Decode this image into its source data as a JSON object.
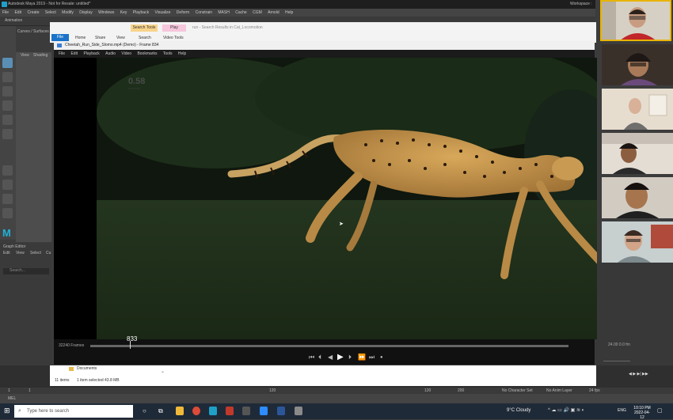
{
  "maya": {
    "title": "Autodesk Maya 2019 - Not for Resale: untitled*",
    "menu": [
      "File",
      "Edit",
      "Create",
      "Select",
      "Modify",
      "Display",
      "Windows",
      "Key",
      "Playback",
      "Visualize",
      "Deform",
      "Constrain",
      "MASH",
      "Cache",
      "CGM",
      "Arnold",
      "Help"
    ],
    "workspace_label": "Workspace :",
    "mode_dropdown": "Animation",
    "curves_tab": "Curves / Surfaces",
    "view_tab": "View",
    "shading_tab": "Shading",
    "graph_editor_title": "Graph Editor",
    "graph_editor_menu": [
      "Edit",
      "View",
      "Select",
      "Cu"
    ],
    "graph_search_placeholder": "Search...",
    "timeline_values": [
      "1",
      "1",
      "120",
      "120",
      "200"
    ],
    "no_character_set": "No Character Set",
    "no_anim_layer": "No Anim Layer",
    "fps": "24 fps",
    "mel_label": "MEL"
  },
  "explorer": {
    "file_tab": "File",
    "tabs": [
      "Home",
      "Share",
      "View"
    ],
    "search_tools": "Search Tools",
    "play": "Play",
    "subtabs": [
      "Search",
      "Video Tools"
    ],
    "address": "run - Search Results in Cat_Locomotion",
    "item_count": "11 items",
    "selected_info": "1 item selected  43.8 MB",
    "documents_label": "Documents"
  },
  "player": {
    "title": "Cheetah_Run_Side_Slomo.mp4 (Demo) - Frame 834",
    "menu": [
      "File",
      "Edit",
      "Playback",
      "Audio",
      "Video",
      "Bookmarks",
      "Tools",
      "Help"
    ],
    "elapsed": "0.58",
    "elapsed_unit": "seconds",
    "frames_total": "32240 Frames",
    "current_frame": "833",
    "playback_speed": 0.006,
    "right_readout": "24.00  0.0   fm",
    "controls": [
      "skip-start",
      "step-back",
      "rewind",
      "play",
      "step-forward",
      "fast-forward",
      "skip-end",
      "record"
    ]
  },
  "taskbar": {
    "search_placeholder": "Type here to search",
    "weather": "9°C  Cloudy",
    "lang": "ENG",
    "time": "10:10 PM",
    "date": "2022-04-12"
  },
  "colors": {
    "maya_accent": "#1fa0c8",
    "explorer_file_tab": "#1a73c8",
    "active_speaker_border": "#e8b400"
  }
}
